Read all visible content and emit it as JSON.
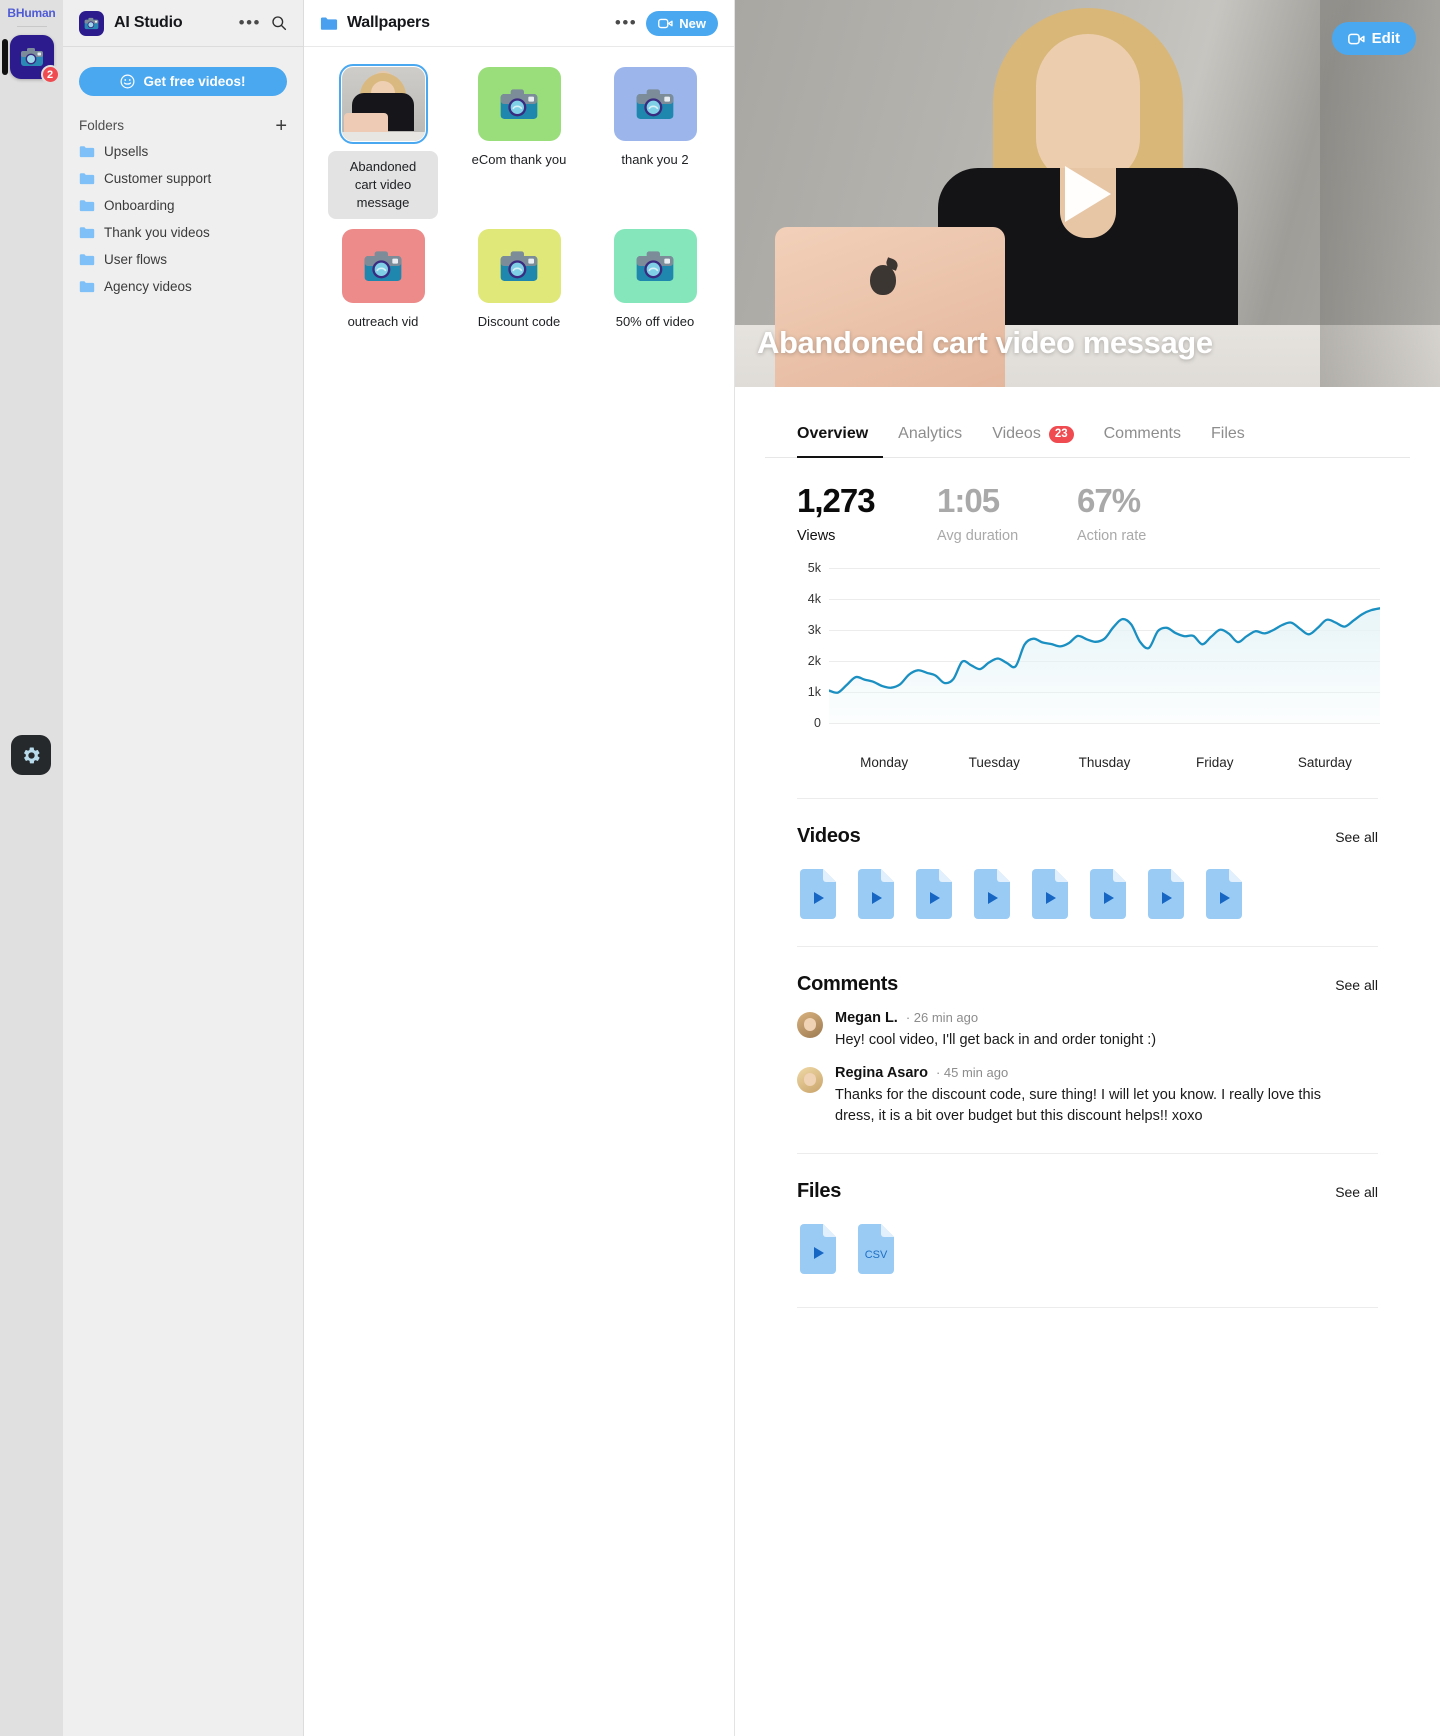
{
  "rail": {
    "brand": "BHuman",
    "avatar_badge": "2",
    "gear_icon": "gear-icon"
  },
  "sidebar": {
    "title": "AI Studio",
    "app_icon": "camera-icon",
    "more_icon": "ellipsis-icon",
    "search_icon": "search-icon",
    "cta_label": "Get free videos!",
    "cta_icon": "smiley-icon",
    "folders_label": "Folders",
    "add_icon": "plus-icon",
    "items": [
      {
        "label": "Upsells",
        "icon": "folder-icon"
      },
      {
        "label": "Customer support",
        "icon": "folder-icon"
      },
      {
        "label": "Onboarding",
        "icon": "folder-icon"
      },
      {
        "label": "Thank you videos",
        "icon": "folder-icon"
      },
      {
        "label": "User flows",
        "icon": "folder-icon"
      },
      {
        "label": "Agency videos",
        "icon": "folder-icon"
      }
    ]
  },
  "files_panel": {
    "title": "Wallpapers",
    "folder_icon": "folder-icon",
    "more_icon": "ellipsis-icon",
    "new_label": "New",
    "new_icon": "video-camera-icon",
    "items": [
      {
        "label": "Abandoned cart video message",
        "type": "photo",
        "selected": true
      },
      {
        "label": "eCom thank you",
        "type": "placeholder",
        "color": "#9ade7c"
      },
      {
        "label": "thank you 2",
        "type": "placeholder",
        "color": "#9cb6ec"
      },
      {
        "label": "outreach vid",
        "type": "placeholder",
        "color": "#ed8a8a"
      },
      {
        "label": "Discount code",
        "type": "placeholder",
        "color": "#dfe878"
      },
      {
        "label": "50% off video",
        "type": "placeholder",
        "color": "#85e6bb"
      }
    ]
  },
  "hero": {
    "title": "Abandoned cart video message",
    "edit_label": "Edit",
    "edit_icon": "video-camera-icon",
    "play_icon": "play-icon"
  },
  "tabs": [
    {
      "label": "Overview",
      "active": true,
      "badge": ""
    },
    {
      "label": "Analytics",
      "active": false,
      "badge": ""
    },
    {
      "label": "Videos",
      "active": false,
      "badge": "23"
    },
    {
      "label": "Comments",
      "active": false,
      "badge": ""
    },
    {
      "label": "Files",
      "active": false,
      "badge": ""
    }
  ],
  "stats": [
    {
      "value": "1,273",
      "label": "Views",
      "muted": false
    },
    {
      "value": "1:05",
      "label": "Avg duration",
      "muted": true
    },
    {
      "value": "67%",
      "label": "Action rate",
      "muted": true
    }
  ],
  "chart_data": {
    "type": "area",
    "title": "",
    "xlabel": "",
    "ylabel": "",
    "categories": [
      "Monday",
      "Tuesday",
      "Thusday",
      "Friday",
      "Saturday"
    ],
    "ytick_labels": [
      "5k",
      "4k",
      "3k",
      "2k",
      "1k",
      "0"
    ],
    "ytick_values": [
      5000,
      4000,
      3000,
      2000,
      1000,
      0
    ],
    "ylim": [
      0,
      5000
    ],
    "grid": true,
    "legend": "none",
    "line_color": "#1a8fc1",
    "fill_color": "#e6f4f7",
    "series": [
      {
        "name": "Views",
        "values": [
          1050,
          980,
          1230,
          1480,
          1400,
          1330,
          1190,
          1140,
          1250,
          1560,
          1700,
          1620,
          1530,
          1290,
          1420,
          1980,
          1860,
          1740,
          1950,
          2080,
          1940,
          1830,
          2530,
          2720,
          2600,
          2550,
          2470,
          2580,
          2810,
          2700,
          2620,
          2720,
          3090,
          3350,
          3180,
          2620,
          2420,
          2960,
          3070,
          2900,
          2800,
          2810,
          2540,
          2780,
          3010,
          2880,
          2610,
          2800,
          2960,
          2890,
          3000,
          3160,
          3240,
          3040,
          2860,
          3070,
          3330,
          3240,
          3110,
          3300,
          3510,
          3640,
          3700
        ]
      }
    ]
  },
  "videos_section": {
    "title": "Videos",
    "see_all": "See all",
    "count": 8,
    "item_icon": "video-file-icon"
  },
  "comments_section": {
    "title": "Comments",
    "see_all": "See all",
    "items": [
      {
        "name": "Megan L.",
        "time": "· 26 min ago",
        "text": "Hey! cool video, I'll get back in and order tonight :)"
      },
      {
        "name": "Regina Asaro",
        "time": "· 45 min ago",
        "text": "Thanks for the discount code, sure thing! I will let you know. I really love this dress, it is a bit over budget but this discount helps!! xoxo"
      }
    ]
  },
  "files_section": {
    "title": "Files",
    "see_all": "See all",
    "items": [
      {
        "kind": "video",
        "label": "",
        "icon": "video-file-icon"
      },
      {
        "kind": "csv",
        "label": "CSV",
        "icon": "csv-file-icon"
      }
    ]
  }
}
